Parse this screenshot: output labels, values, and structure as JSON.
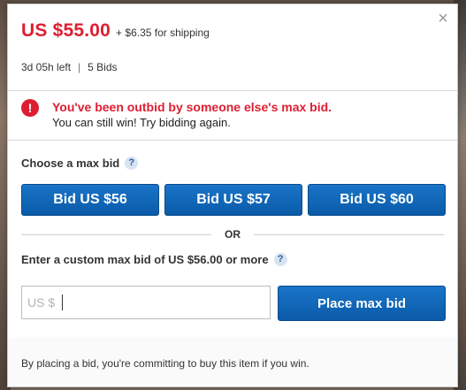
{
  "price": {
    "amount": "US $55.00",
    "shipping": "+ $6.35 for shipping",
    "time_left": "3d 05h left",
    "separator": "|",
    "bids": "5 Bids"
  },
  "alert": {
    "icon": "!",
    "title": "You've been outbid by someone else's max bid.",
    "message": "You can still win! Try bidding again."
  },
  "choose": {
    "label": "Choose a max bid",
    "help": "?",
    "options": [
      "Bid US $56",
      "Bid US $57",
      "Bid US $60"
    ]
  },
  "or_label": "OR",
  "custom": {
    "label": "Enter a custom max bid of US $56.00 or more",
    "help": "?",
    "prefix": "US $",
    "value": "",
    "place_button": "Place max bid"
  },
  "footer": {
    "text": "By placing a bid, you're committing to buy this item if you win."
  },
  "close_glyph": "×",
  "colors": {
    "price_red": "#dd1e31",
    "button_blue": "#0f65b8",
    "alert_red": "#dd1e31"
  }
}
